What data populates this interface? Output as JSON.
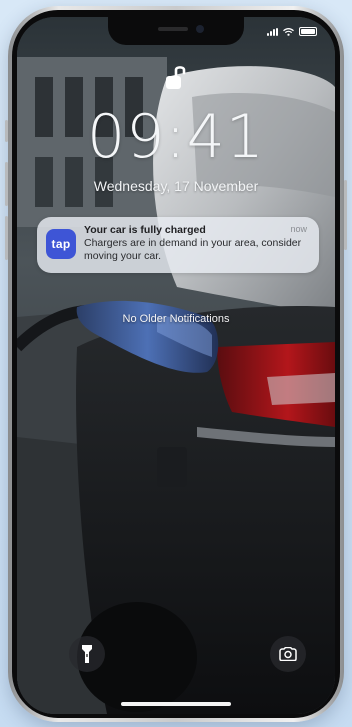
{
  "lock_screen": {
    "time": "09:41",
    "date": "Wednesday, 17 November",
    "footer_text": "No Older Notifications"
  },
  "notification": {
    "app_icon_text": "tap",
    "title": "Your car is fully charged",
    "time": "now",
    "body": "Chargers are in demand in your area, consider moving your car."
  },
  "icons": {
    "lock": "unlocked-padlock-icon",
    "flashlight": "flashlight-icon",
    "camera": "camera-icon",
    "signal": "signal-icon",
    "wifi": "wifi-icon",
    "battery": "battery-icon"
  },
  "colors": {
    "app_accent": "#3e55d6",
    "background": "#cfe3f5"
  }
}
